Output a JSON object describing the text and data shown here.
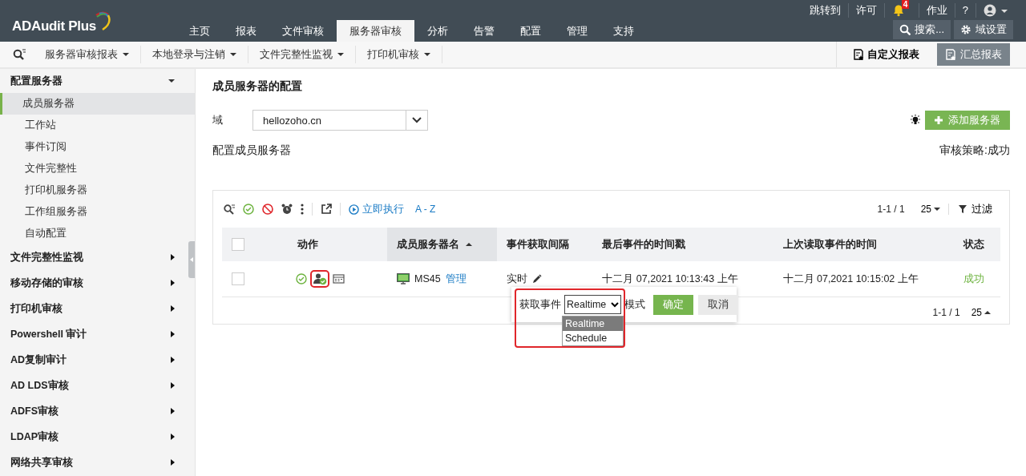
{
  "app": {
    "logo": "ADAudit Plus"
  },
  "top_links": [
    {
      "label": "跳转到",
      "kind": "text"
    },
    {
      "label": "许可",
      "kind": "text"
    },
    {
      "label": "4",
      "kind": "bell"
    },
    {
      "label": "作业",
      "kind": "text"
    },
    {
      "label": "?",
      "kind": "text"
    },
    {
      "kind": "avatar"
    }
  ],
  "nav_tabs": [
    {
      "label": "主页",
      "selected": false
    },
    {
      "label": "报表",
      "selected": false
    },
    {
      "label": "文件审核",
      "selected": false
    },
    {
      "label": "服务器审核",
      "selected": true
    },
    {
      "label": "分析",
      "selected": false
    },
    {
      "label": "告警",
      "selected": false
    },
    {
      "label": "配置",
      "selected": false
    },
    {
      "label": "管理",
      "selected": false
    },
    {
      "label": "支持",
      "selected": false
    }
  ],
  "header_buttons": [
    {
      "label": "搜索...",
      "kind": "search"
    },
    {
      "label": "域设置",
      "kind": "settings"
    }
  ],
  "sub_menus": [
    "服务器审核报表",
    "本地登录与注销",
    "文件完整性监视",
    "打印机审核"
  ],
  "report_buttons": [
    {
      "label": "自定义报表",
      "kind": "link"
    },
    {
      "label": "汇总报表",
      "kind": "button"
    }
  ],
  "sidebar": [
    {
      "label": "配置服务器",
      "expanded": true,
      "children": [
        {
          "label": "成员服务器",
          "selected": true
        },
        {
          "label": "工作站",
          "selected": false
        },
        {
          "label": "事件订阅",
          "selected": false
        },
        {
          "label": "文件完整性",
          "selected": false
        },
        {
          "label": "打印机服务器",
          "selected": false
        },
        {
          "label": "工作组服务器",
          "selected": false
        },
        {
          "label": "自动配置",
          "selected": false
        }
      ]
    },
    {
      "label": "文件完整性监视",
      "expanded": false
    },
    {
      "label": "移动存储的审核",
      "expanded": false
    },
    {
      "label": "打印机审核",
      "expanded": false
    },
    {
      "label": "Powershell 审计",
      "expanded": false
    },
    {
      "label": "AD复制审计",
      "expanded": false
    },
    {
      "label": "AD LDS审核",
      "expanded": false
    },
    {
      "label": "ADFS审核",
      "expanded": false
    },
    {
      "label": "LDAP审核",
      "expanded": false
    },
    {
      "label": "网络共享审核",
      "expanded": false
    }
  ],
  "page": {
    "title": "成员服务器的配置",
    "domain_label": "域",
    "domain_value": "hellozoho.cn",
    "add_button": "添加服务器",
    "section_title": "配置成员服务器",
    "audit_policy": "审核策略:成功"
  },
  "table": {
    "select_all_checked": false,
    "toolbar": {
      "run_now": "立即执行",
      "sort": "A - Z",
      "pagination": "1-1 / 1",
      "page_size": "25",
      "filter": "过滤"
    },
    "columns": [
      {
        "label": "动作",
        "sorted": false
      },
      {
        "label": "成员服务器名",
        "sorted": true
      },
      {
        "label": "事件获取间隔",
        "sorted": false
      },
      {
        "label": "最后事件的时间戳",
        "sorted": false
      },
      {
        "label": "上次读取事件的时间",
        "sorted": false
      },
      {
        "label": "状态",
        "sorted": false
      }
    ],
    "rows": [
      {
        "checked": false,
        "server": "MS45",
        "manage": "管理",
        "interval": "实时",
        "last_event": "十二月 07,2021 10:13:43 上午",
        "last_read": "十二月 07,2021 10:15:02 上午",
        "status": "成功"
      }
    ],
    "footer_pagination": "1-1 / 1",
    "footer_page_size": "25"
  },
  "popup": {
    "label": "获取事件",
    "select_value": "Realtime",
    "suffix": "模式",
    "ok": "确定",
    "cancel": "取消",
    "options": [
      {
        "label": "Realtime",
        "selected": true
      },
      {
        "label": "Schedule",
        "selected": false
      }
    ]
  }
}
